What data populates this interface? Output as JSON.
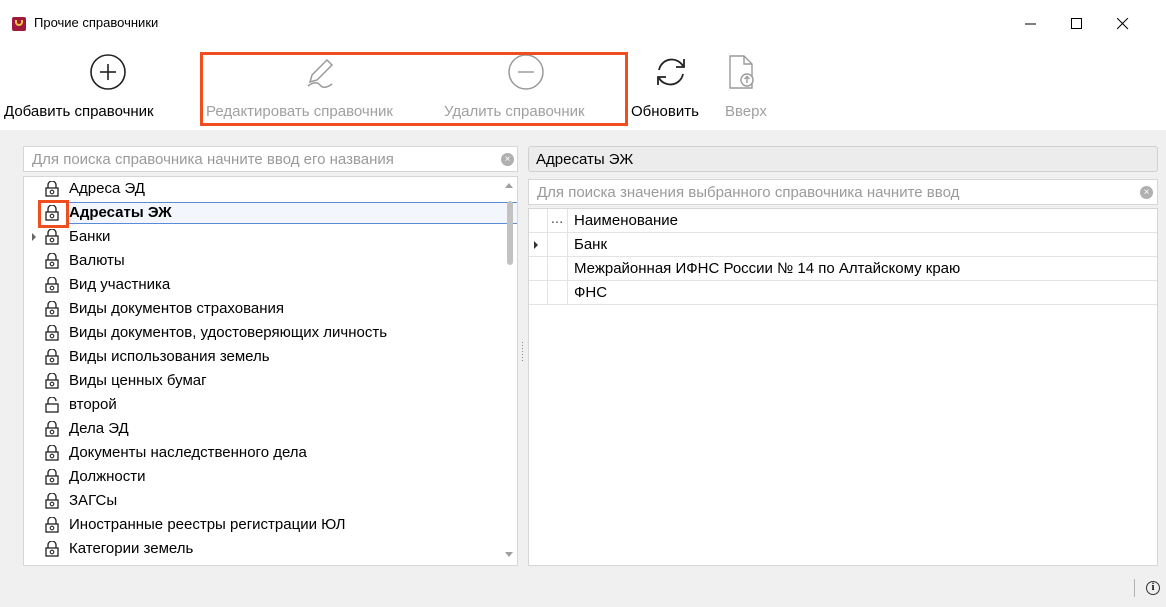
{
  "window": {
    "title": "Прочие справочники"
  },
  "toolbar": {
    "add_label": "Добавить справочник",
    "edit_label": "Редактировать справочник",
    "delete_label": "Удалить справочник",
    "refresh_label": "Обновить",
    "up_label": "Вверх"
  },
  "left": {
    "search_placeholder": "Для поиска справочника начните ввод его названия",
    "items": [
      {
        "label": "Адреса ЭД",
        "icon": "lock-icon"
      },
      {
        "label": "Адресаты ЭЖ",
        "icon": "lock-icon",
        "selected": true
      },
      {
        "label": "Банки",
        "icon": "lock-icon",
        "expandable": true
      },
      {
        "label": "Валюты",
        "icon": "lock-icon"
      },
      {
        "label": "Вид участника",
        "icon": "lock-icon"
      },
      {
        "label": "Виды документов страхования",
        "icon": "lock-icon"
      },
      {
        "label": "Виды документов, удостоверяющих личность",
        "icon": "lock-icon"
      },
      {
        "label": "Виды использования земель",
        "icon": "lock-icon"
      },
      {
        "label": "Виды ценных бумаг",
        "icon": "lock-icon"
      },
      {
        "label": "второй",
        "icon": "unlock-icon"
      },
      {
        "label": "Дела ЭД",
        "icon": "lock-icon"
      },
      {
        "label": "Документы наследственного дела",
        "icon": "lock-icon"
      },
      {
        "label": "Должности",
        "icon": "lock-icon"
      },
      {
        "label": "ЗАГСы",
        "icon": "lock-icon"
      },
      {
        "label": "Иностранные реестры регистрации ЮЛ",
        "icon": "lock-icon"
      },
      {
        "label": "Категории земель",
        "icon": "lock-icon"
      }
    ]
  },
  "right": {
    "header_title": "Адресаты ЭЖ",
    "search_placeholder": "Для поиска значения выбранного справочника начните ввод",
    "grid": {
      "dots": "...",
      "column": "Наименование",
      "rows": [
        "Банк",
        "Межрайонная ИФНС России № 14 по Алтайскому краю",
        "ФНС"
      ]
    }
  },
  "colors": {
    "highlight": "#f04e1e",
    "selection_border": "#5a8bd6"
  }
}
